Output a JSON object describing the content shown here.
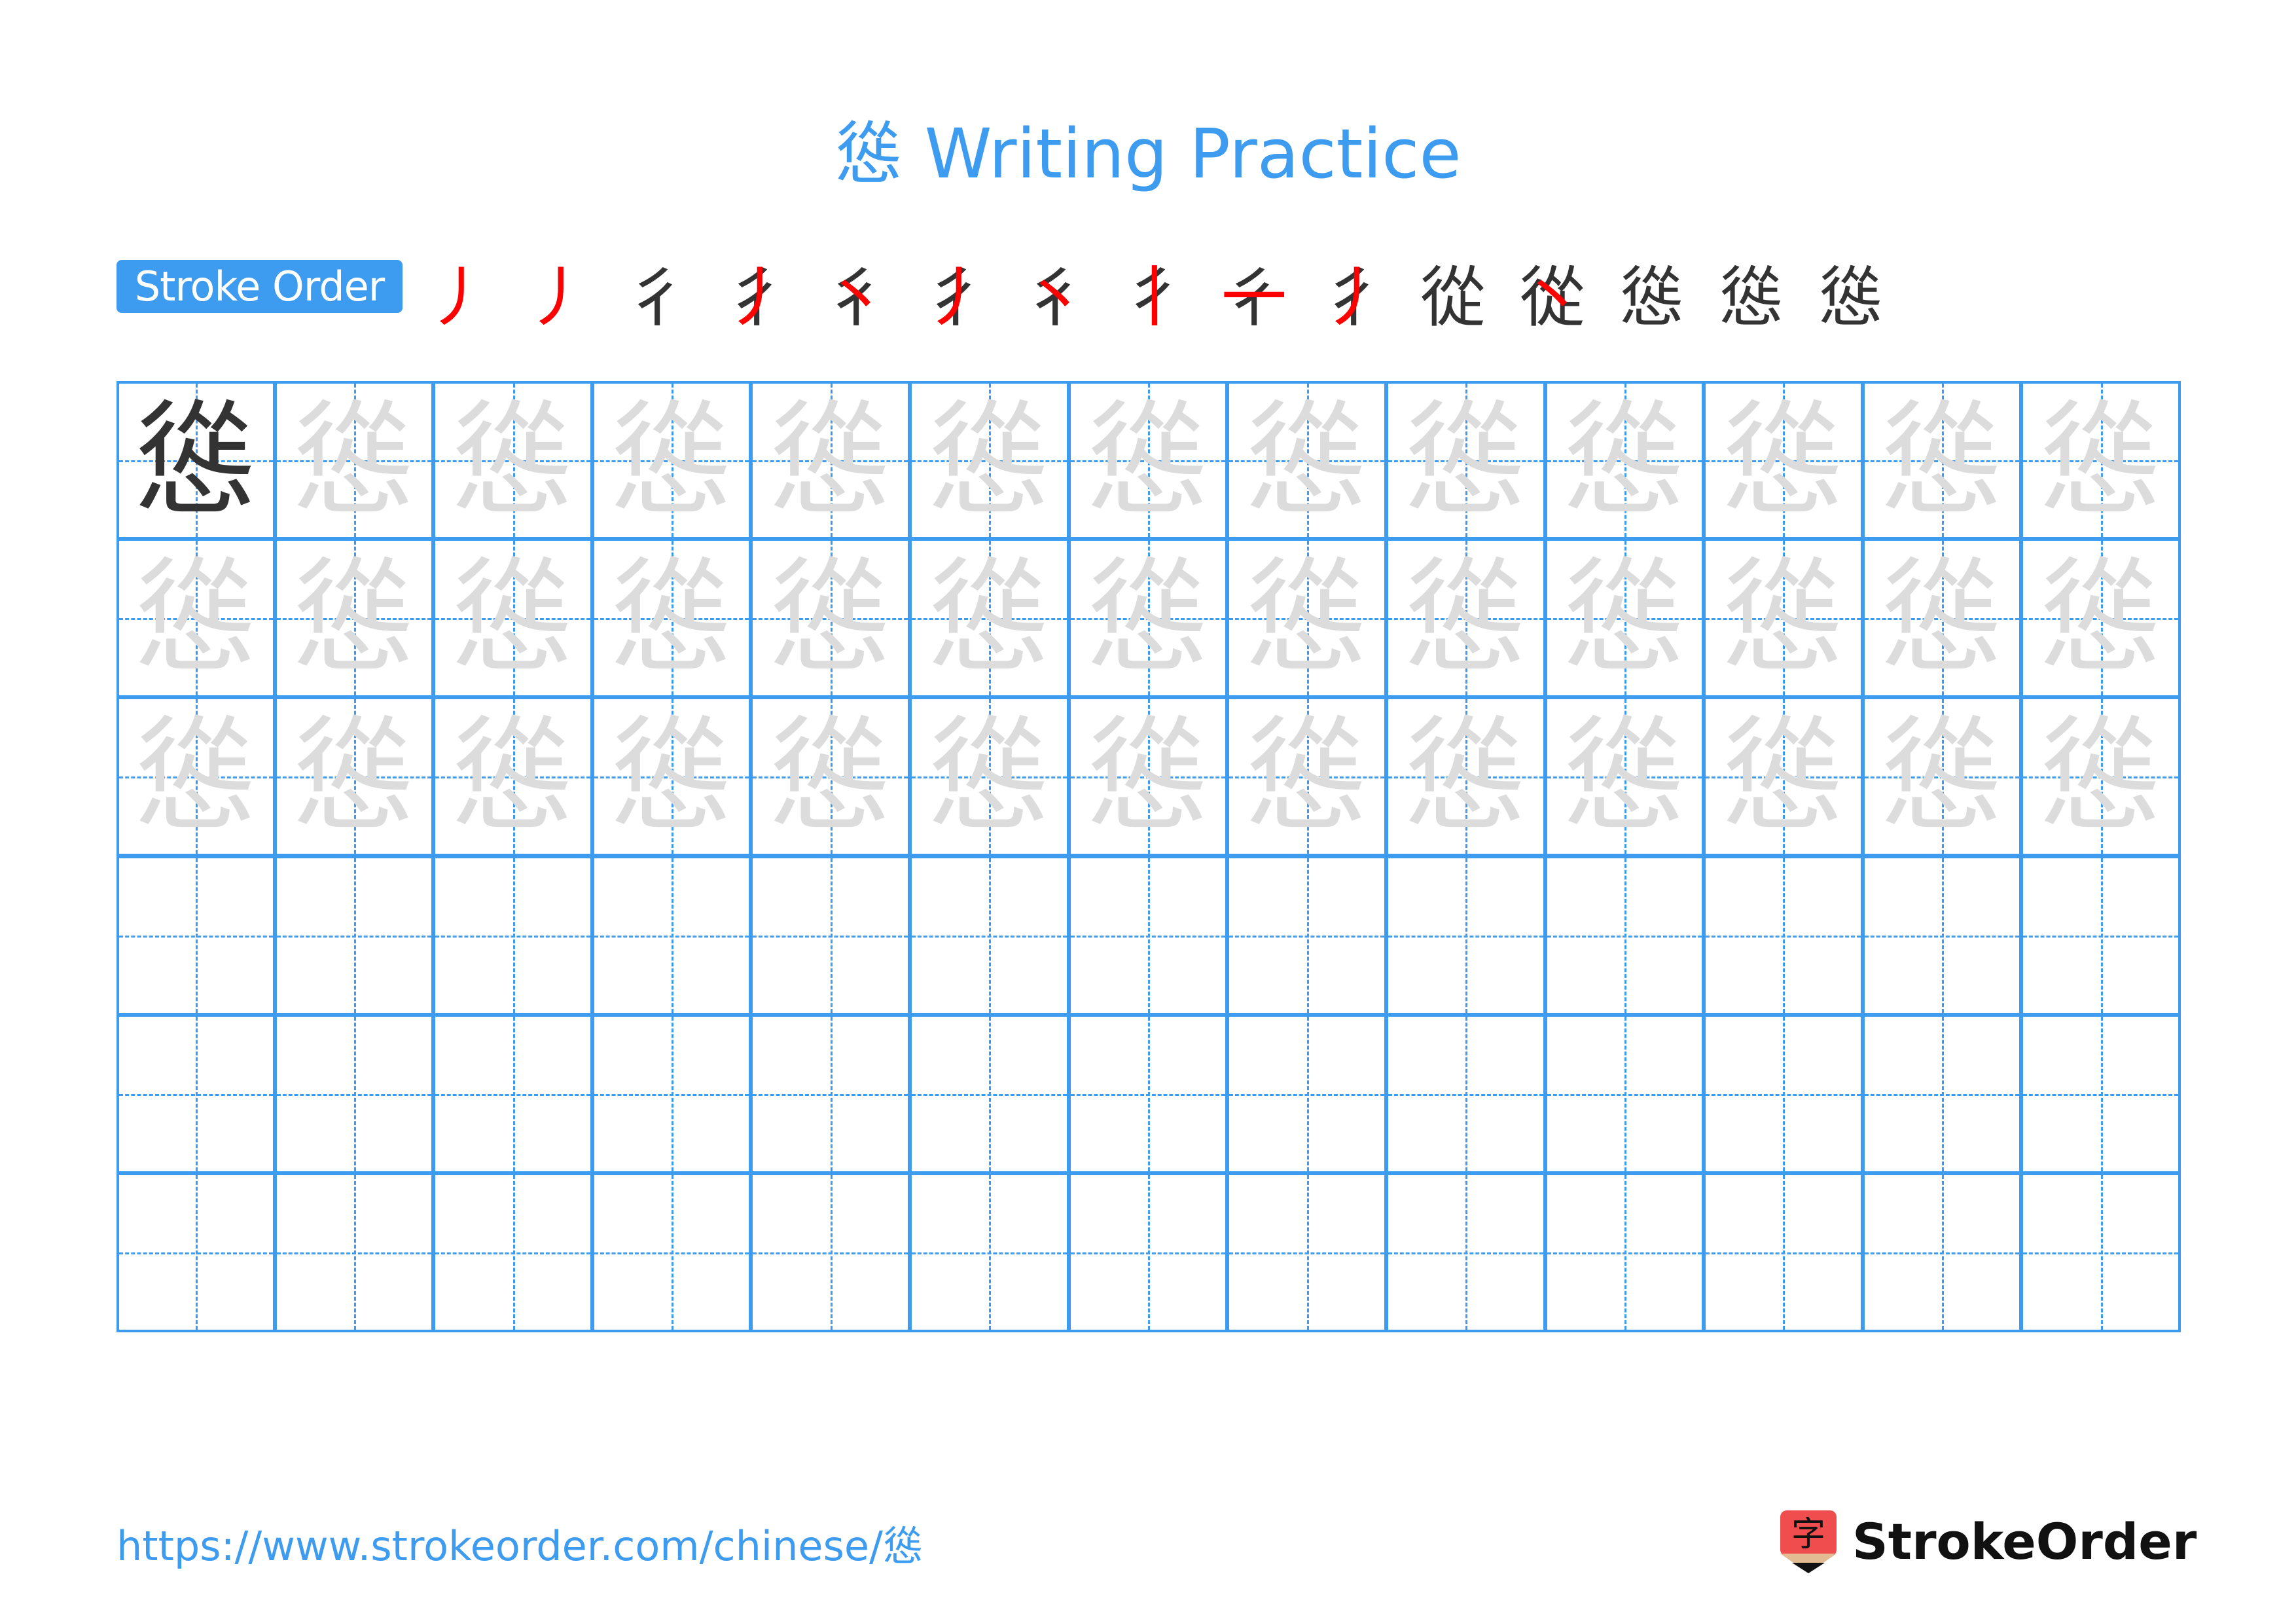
{
  "page": {
    "title": "慫 Writing Practice",
    "character": "慫",
    "colors": {
      "accent": "#3d9bf0",
      "model_char": "#333333",
      "trace_char": "#dcdcdc",
      "new_stroke": "#ff0000",
      "logo_red": "#f04e4e"
    }
  },
  "stroke_order": {
    "label": "Stroke Order",
    "total_strokes": 15,
    "steps": [
      {
        "done": "",
        "new": "丿"
      },
      {
        "done": "丿",
        "new": "丿"
      },
      {
        "done": "彳",
        "new": ""
      },
      {
        "done": "彳",
        "new": "丿"
      },
      {
        "done": "彳",
        "new": "丶"
      },
      {
        "done": "彳",
        "new": "丿"
      },
      {
        "done": "彳",
        "new": "丶"
      },
      {
        "done": "彳",
        "new": "丨"
      },
      {
        "done": "彳",
        "new": "一"
      },
      {
        "done": "彳",
        "new": "丿"
      },
      {
        "done": "從",
        "new": ""
      },
      {
        "done": "從",
        "new": "丶"
      },
      {
        "done": "慫",
        "new": ""
      },
      {
        "done": "慫",
        "new": ""
      },
      {
        "done": "慫",
        "new": ""
      }
    ]
  },
  "grid": {
    "columns": 13,
    "rows": 6,
    "rows_content": [
      {
        "type": "model_then_trace"
      },
      {
        "type": "trace"
      },
      {
        "type": "trace"
      },
      {
        "type": "empty"
      },
      {
        "type": "empty"
      },
      {
        "type": "empty"
      }
    ]
  },
  "footer": {
    "url": "https://www.strokeorder.com/chinese/慫",
    "logo_glyph": "字",
    "logo_text": "StrokeOrder"
  }
}
